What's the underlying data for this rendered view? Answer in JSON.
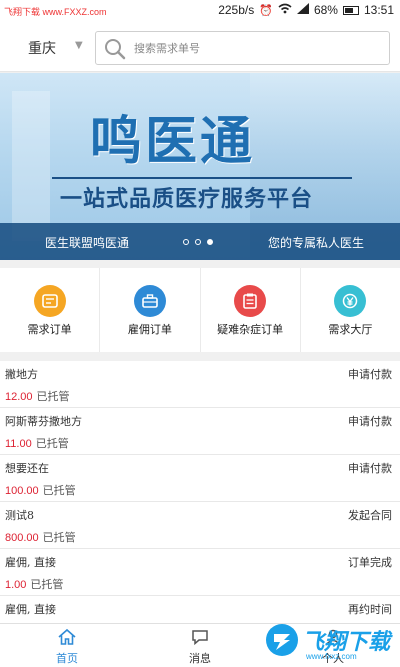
{
  "status_bar": {
    "watermark": "飞翔下载 www.FXXZ.com",
    "speed": "225b/s",
    "battery": "68%",
    "battery_level": 0.68,
    "time": "13:51"
  },
  "header": {
    "city": "重庆",
    "search_placeholder": "搜索需求单号"
  },
  "banner": {
    "title": "鸣医通",
    "subtitle": "一站式品质医疗服务平台",
    "left_text": "医生联盟鸣医通",
    "right_text": "您的专属私人医生",
    "dots": 3,
    "active_dot": 3
  },
  "grid": [
    {
      "label": "需求订单",
      "color": "#f5a623",
      "icon": "note-icon"
    },
    {
      "label": "雇佣订单",
      "color": "#2e8ad6",
      "icon": "briefcase-icon"
    },
    {
      "label": "疑难杂症订单",
      "color": "#e84a4a",
      "icon": "clipboard-icon"
    },
    {
      "label": "需求大厅",
      "color": "#37bfd3",
      "icon": "yen-icon"
    }
  ],
  "orders": [
    {
      "name": "撇地方",
      "status": "申请付款",
      "amount": "12.00",
      "tag": "已托管"
    },
    {
      "name": "阿斯蒂芬撒地方",
      "status": "申请付款",
      "amount": "11.00",
      "tag": "已托管"
    },
    {
      "name": "想要还在",
      "status": "申请付款",
      "amount": "100.00",
      "tag": "已托管"
    },
    {
      "name": "测试8",
      "status": "发起合同",
      "amount": "800.00",
      "tag": "已托管"
    },
    {
      "name": "雇佣, 直接",
      "status": "订单完成",
      "amount": "1.00",
      "tag": "已托管"
    },
    {
      "name": "雇佣, 直接",
      "status": "再约时间",
      "amount": "",
      "tag": ""
    }
  ],
  "tabs": [
    {
      "label": "首页",
      "icon": "home-icon",
      "active": true
    },
    {
      "label": "消息",
      "icon": "chat-icon",
      "active": false
    },
    {
      "label": "个人",
      "icon": "person-icon",
      "active": false
    }
  ],
  "ad": {
    "text": "飞翔下载",
    "sub": "www.fxxz.com"
  },
  "colors": {
    "accent": "#2e8ad6",
    "amount": "#dd2233",
    "banner_bar": "#194e82"
  }
}
